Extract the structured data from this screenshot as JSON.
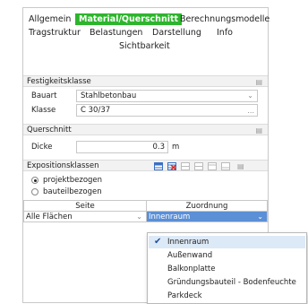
{
  "tabs": {
    "allgemein": "Allgemein",
    "material": "Material/Querschnitt",
    "berechnung": "Berechnungsmodelle",
    "tragstruktur": "Tragstruktur",
    "belastungen": "Belastungen",
    "darstellung": "Darstellung",
    "info": "Info",
    "sichtbarkeit": "Sichtbarkeit"
  },
  "festigkeitsklasse": {
    "title": "Festigkeitsklasse",
    "bauart_label": "Bauart",
    "bauart_value": "Stahlbetonbau",
    "klasse_label": "Klasse",
    "klasse_value": "C 30/37",
    "klasse_btn": "..."
  },
  "querschnitt": {
    "title": "Querschnitt",
    "dicke_label": "Dicke",
    "dicke_value": "0.3",
    "dicke_unit": "m"
  },
  "exposition": {
    "title": "Expositionsklassen",
    "radio_project": "projektbezogen",
    "radio_component": "bauteilbezogen",
    "col_seite": "Seite",
    "col_zuordnung": "Zuordnung",
    "row_seite": "Alle Flächen",
    "row_zuordnung": "Innenraum"
  },
  "dropdown_options": [
    "Innenraum",
    "Außenwand",
    "Balkonplatte",
    "Gründungsbauteil - Bodenfeuchte",
    "Parkdeck"
  ],
  "colors": {
    "active_tab": "#2db52d",
    "selected_row": "#5b8fd6",
    "toolbar_blue": "#3a6fc4",
    "toolbar_red": "#d03030"
  }
}
